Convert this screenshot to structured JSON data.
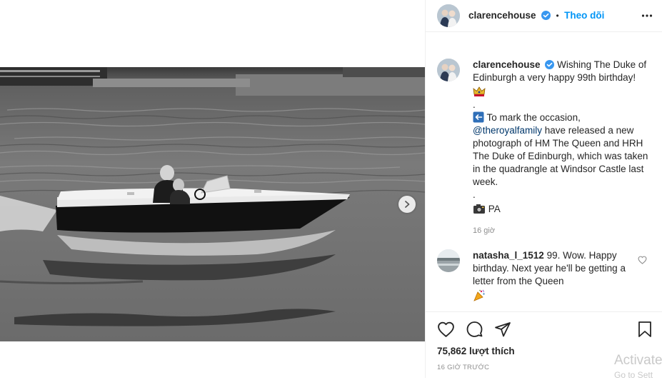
{
  "post": {
    "image_alt": "Black and white photo of a man and a boy driving a small speedboat on water",
    "next_icon": "chevron-right-icon"
  },
  "header": {
    "username": "clarencehouse",
    "verified_icon": "verified-badge-icon",
    "separator": "•",
    "follow_label": "Theo dõi",
    "more_icon": "ellipsis-icon"
  },
  "caption": {
    "username": "clarencehouse",
    "line1": "Wishing The Duke of Edinburgh a very happy 99th birthday!",
    "emoji1": "crown-icon",
    "dot1": ".",
    "arrow_icon": "left-arrow-icon",
    "line2a": "To mark the occasion,",
    "mention": "@theroyalfamily",
    "line2b": "have released a new photograph of HM The Queen and HRH The Duke of Edinburgh, which was taken in the quadrangle at Windsor Castle last week.",
    "dot2": ".",
    "camera_icon": "camera-icon",
    "credit": "PA",
    "time": "16 giờ"
  },
  "comment": {
    "username": "natasha_l_1512",
    "text": "99. Wow. Happy birthday. Next year he'll be getting a letter from the Queen",
    "emoji": "party-popper-icon",
    "like_icon": "heart-outline-icon"
  },
  "actions": {
    "like_icon": "heart-icon",
    "comment_icon": "comment-icon",
    "share_icon": "send-icon",
    "save_icon": "bookmark-icon",
    "likes": "75,862 lượt thích",
    "timestamp": "16 GIỜ TRƯỚC"
  },
  "overlay": {
    "activate_line1": "Activate",
    "activate_line2": "Go to Sett"
  },
  "colors": {
    "accent": "#0095f6",
    "verified": "#3897f0",
    "text": "#262626",
    "muted": "#8e8e8e",
    "border": "#efefef"
  }
}
